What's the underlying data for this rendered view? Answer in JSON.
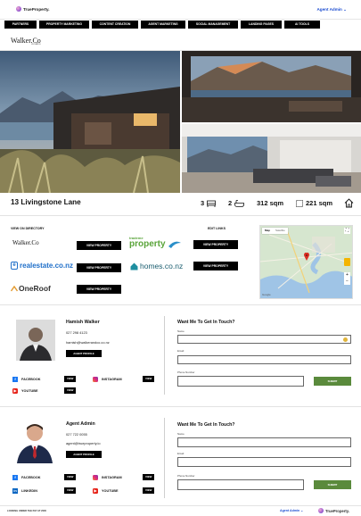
{
  "header": {
    "brand": "TrueProperty.",
    "admin_menu": "Agent Admin ⌄"
  },
  "nav": [
    "PARTNERS AREA",
    "PROPERTY MARKETING",
    "CONTENT CREATION",
    "AGENT MARKETING",
    "SOCIAL MANAGEMENT",
    "LANDING PAGES",
    "AI TOOLS"
  ],
  "agency_logo": {
    "name": "Walker.Co",
    "sub": "HOMES"
  },
  "property": {
    "address": "13 Livingstone Lane",
    "bedrooms": "3",
    "bathrooms": "2",
    "floor_area": "312 sqm",
    "land_area": "221 sqm"
  },
  "directory": {
    "title": "VIEW ON DIRECTORY",
    "edit_links": "EDIT LINKS",
    "view_button": "VIEW PROPERTY",
    "sites": [
      "Walker.Co",
      "trademe property",
      "realestate.co.nz",
      "homes.co.nz",
      "OneRoof"
    ]
  },
  "map": {
    "tab_map": "Map",
    "tab_satellite": "Satellite"
  },
  "agents": [
    {
      "name": "Hamish Walker",
      "phone": "027 298 4123",
      "email": "hamish@walkerandco.co.nz",
      "profile_button": "AGENT PROFILE",
      "socials": [
        {
          "label": "FACEBOOK",
          "view": "VIEW"
        },
        {
          "label": "INSTAGRAM",
          "view": "VIEW"
        },
        {
          "label": "YOUTUBE",
          "view": "VIEW"
        }
      ]
    },
    {
      "name": "Agent Admin",
      "phone": "027 722 0055",
      "email": "agent@trueproperty.io",
      "profile_button": "AGENT PROFILE",
      "socials": [
        {
          "label": "FACEBOOK",
          "view": "VIEW"
        },
        {
          "label": "INSTAGRAM",
          "view": "VIEW"
        },
        {
          "label": "LINKEDIN",
          "view": "VIEW"
        },
        {
          "label": "YOUTUBE",
          "view": "VIEW"
        }
      ]
    }
  ],
  "contact_form": {
    "title": "Want Me To Get In Touch?",
    "name_label": "Name",
    "email_label": "Email",
    "phone_label": "Phone Number",
    "submit": "SUBMIT"
  },
  "footer": {
    "left": "LOOKING UNDER THE PAY AT 2000",
    "admin": "Agent Admin ⌄",
    "brand": "TrueProperty."
  },
  "colors": {
    "accent": "#1f4fd1",
    "submit": "#5a8a3c",
    "nav_bg": "#000000"
  }
}
